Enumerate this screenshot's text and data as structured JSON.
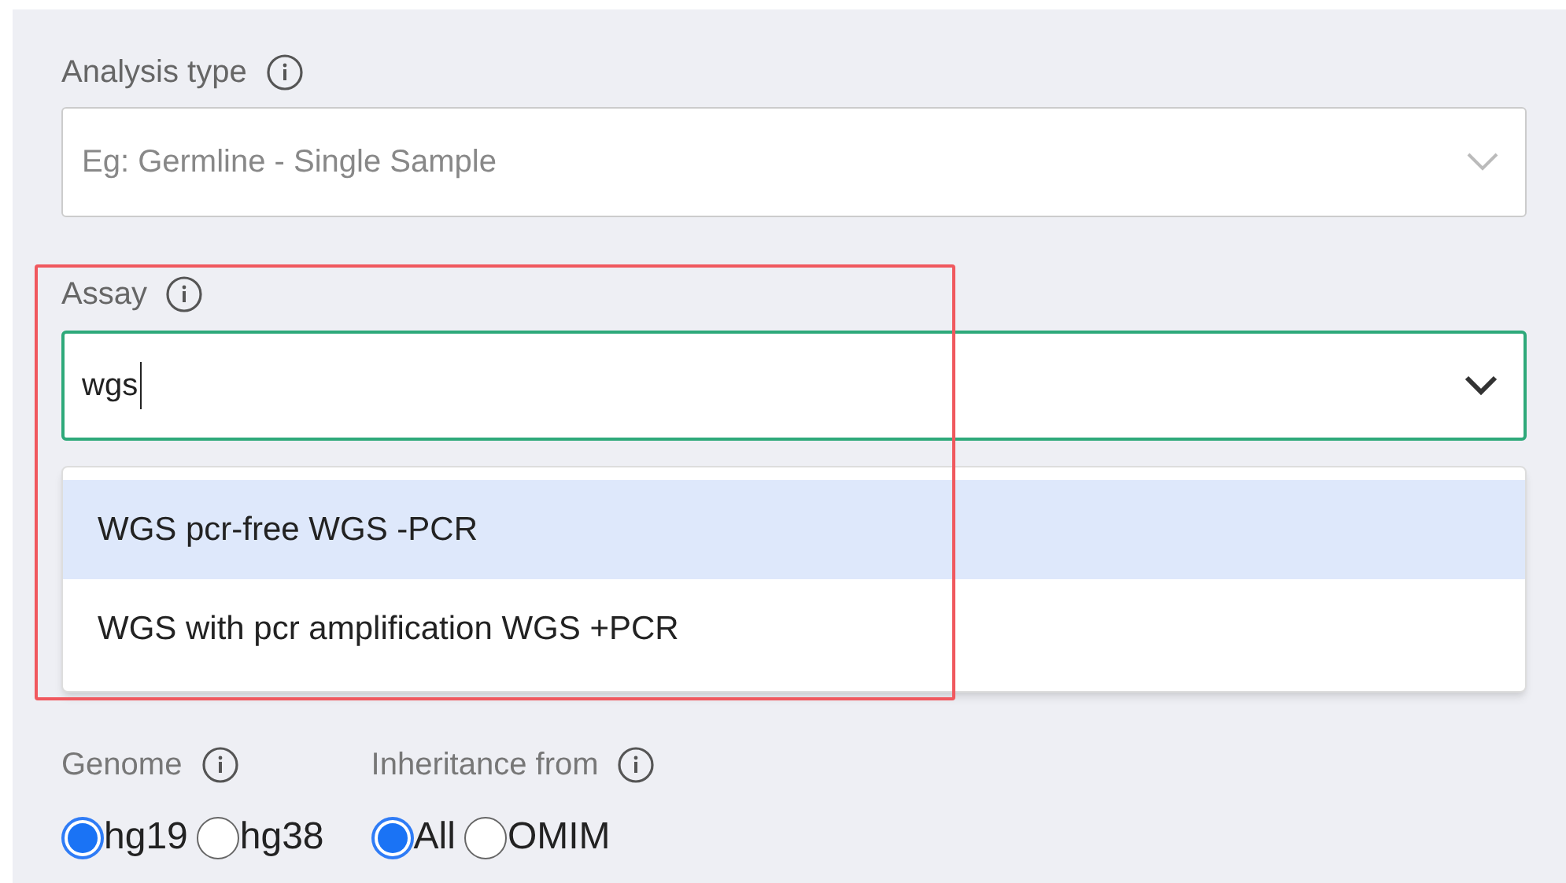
{
  "analysis_type": {
    "label": "Analysis type",
    "placeholder": "Eg: Germline - Single Sample"
  },
  "assay": {
    "label": "Assay",
    "value": "wgs",
    "options": [
      {
        "label": "WGS pcr-free WGS -PCR",
        "selected": true
      },
      {
        "label": "WGS with pcr amplification WGS +PCR",
        "selected": false
      }
    ]
  },
  "radio_groups": [
    {
      "label": "Genome",
      "options": [
        {
          "label": "hg19",
          "selected": true
        },
        {
          "label": "hg38",
          "selected": false
        }
      ]
    },
    {
      "label": "Inheritance from",
      "options": [
        {
          "label": "All",
          "selected": true
        },
        {
          "label": "OMIM",
          "selected": false
        }
      ]
    }
  ]
}
